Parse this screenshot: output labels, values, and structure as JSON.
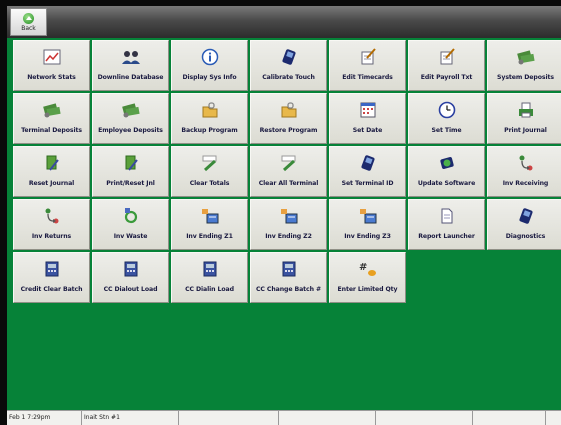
{
  "toolbar": {
    "back_label": "Back"
  },
  "tiles": [
    {
      "label": "Network Stats",
      "icon": "chart-icon"
    },
    {
      "label": "Downline Database",
      "icon": "people-icon"
    },
    {
      "label": "Display Sys Info",
      "icon": "info-icon"
    },
    {
      "label": "Calibrate Touch",
      "icon": "handheld-icon"
    },
    {
      "label": "Edit Timecards",
      "icon": "edit-doc-icon"
    },
    {
      "label": "Edit Payroll Txt",
      "icon": "edit-doc-icon"
    },
    {
      "label": "System Deposits",
      "icon": "money-icon"
    },
    {
      "label": "Terminal Deposits",
      "icon": "money-icon"
    },
    {
      "label": "Employee Deposits",
      "icon": "money-icon"
    },
    {
      "label": "Backup Program",
      "icon": "folder-lock-icon"
    },
    {
      "label": "Restore Program",
      "icon": "folder-lock-icon"
    },
    {
      "label": "Set Date",
      "icon": "calendar-icon"
    },
    {
      "label": "Set Time",
      "icon": "clock-icon"
    },
    {
      "label": "Print Journal",
      "icon": "printer-icon"
    },
    {
      "label": "Reset Journal",
      "icon": "journal-icon"
    },
    {
      "label": "Print/Reset Jnl",
      "icon": "journal-icon"
    },
    {
      "label": "Clear Totals",
      "icon": "eraser-icon"
    },
    {
      "label": "Clear All Terminal",
      "icon": "eraser-icon"
    },
    {
      "label": "Set Terminal ID",
      "icon": "handheld-icon"
    },
    {
      "label": "Update Software",
      "icon": "update-icon"
    },
    {
      "label": "Inv Receiving",
      "icon": "transfer-icon"
    },
    {
      "label": "Inv Returns",
      "icon": "transfer-icon"
    },
    {
      "label": "Inv Waste",
      "icon": "recycle-icon"
    },
    {
      "label": "Inv Ending Z1",
      "icon": "inventory-icon"
    },
    {
      "label": "Inv Ending Z2",
      "icon": "inventory-icon"
    },
    {
      "label": "Inv Ending Z3",
      "icon": "inventory-icon"
    },
    {
      "label": "Report Launcher",
      "icon": "report-icon"
    },
    {
      "label": "Diagnostics",
      "icon": "handheld-icon"
    },
    {
      "label": "Credit Clear Batch",
      "icon": "register-icon"
    },
    {
      "label": "CC Dialout Load",
      "icon": "register-icon"
    },
    {
      "label": "CC Dialin Load",
      "icon": "register-icon"
    },
    {
      "label": "CC Change Batch #",
      "icon": "register-icon"
    },
    {
      "label": "Enter Limited Qty",
      "icon": "hash-icon"
    }
  ],
  "status": {
    "datetime": "Feb 1  7:29pm",
    "terminal": "Inait Stn #1",
    "cells": [
      "",
      "",
      "",
      "",
      "",
      "",
      ""
    ]
  },
  "colors": {
    "background": "#068238",
    "tile": "#e6e6de",
    "label": "#1a1a40"
  }
}
